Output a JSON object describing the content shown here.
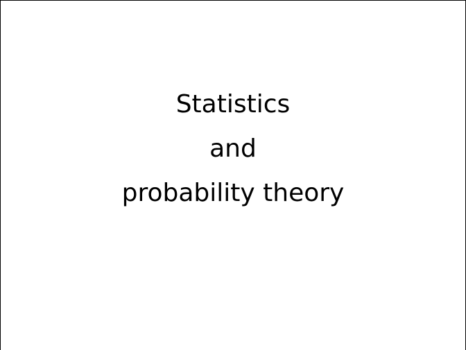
{
  "slide": {
    "title_lines": [
      "Statistics",
      "and",
      "probability theory"
    ]
  }
}
